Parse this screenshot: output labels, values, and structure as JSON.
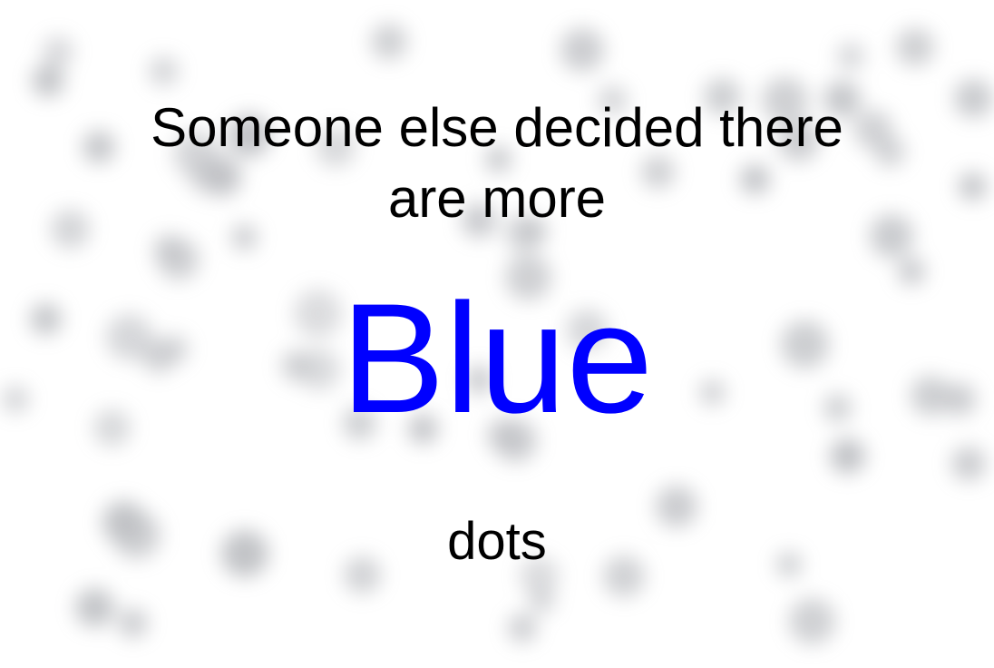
{
  "prompt": {
    "line1": "Someone else decided there",
    "line2": "are more",
    "color_word": "Blue",
    "line3": "dots"
  },
  "colors": {
    "background": "#ffffff",
    "text": "#000000",
    "color_word": "#0000ff",
    "dots": "#8c8f96"
  },
  "background_dots": {
    "style": "blurred gray dots",
    "count": 70
  }
}
